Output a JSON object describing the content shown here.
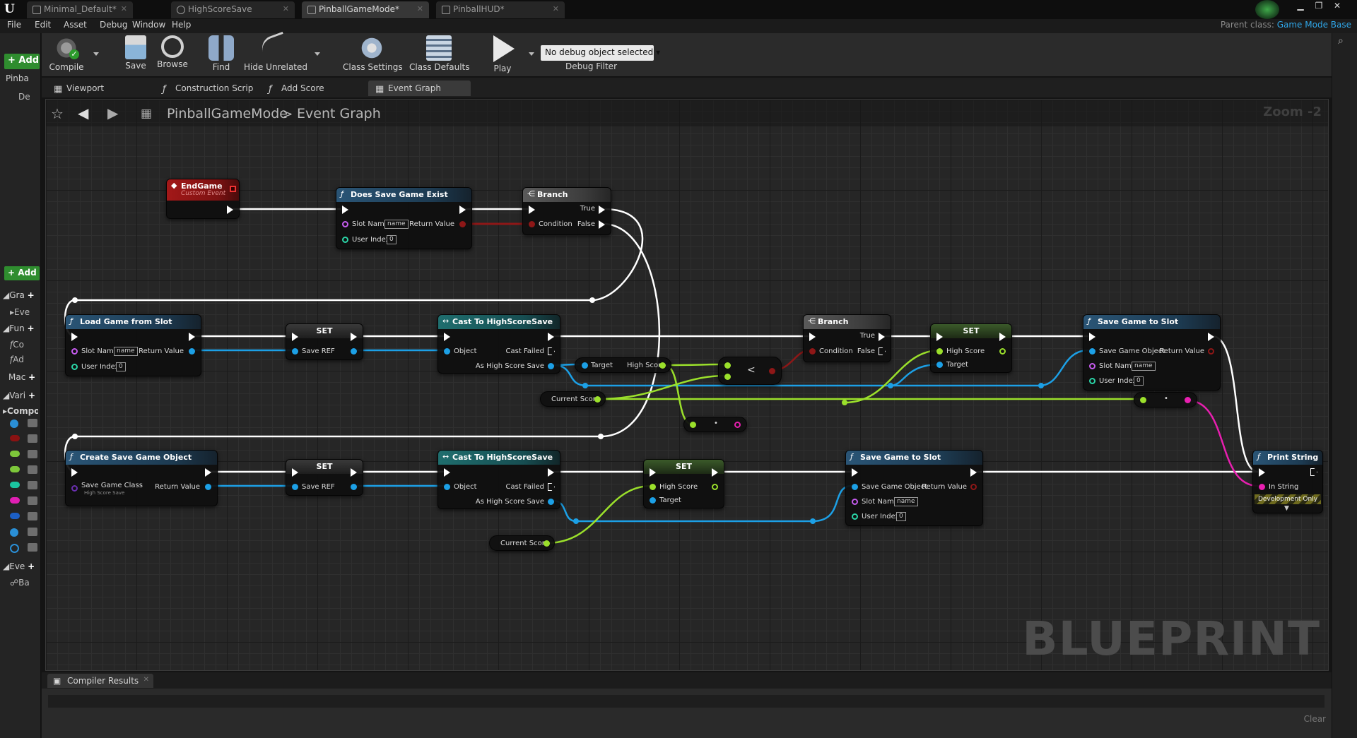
{
  "titlebar": {
    "tabs": [
      {
        "label": "Minimal_Default*",
        "icon": "level-icon"
      },
      {
        "label": "HighScoreSave",
        "icon": "savegame-icon"
      },
      {
        "label": "PinballGameMode*",
        "icon": "blueprint-icon"
      },
      {
        "label": "PinballHUD*",
        "icon": "widget-icon"
      }
    ],
    "parent_prefix": "Parent class:",
    "parent_class": "Game Mode Base"
  },
  "menu": [
    "File",
    "Edit",
    "Asset",
    "Debug",
    "Window",
    "Help"
  ],
  "toolbar": {
    "compile": "Compile",
    "save": "Save",
    "browse": "Browse",
    "find": "Find",
    "hide_unrelated": "Hide Unrelated",
    "class_settings": "Class Settings",
    "class_defaults": "Class Defaults",
    "play": "Play",
    "debug_select": "No debug object selected",
    "debug_filter": "Debug Filter"
  },
  "left_panel": {
    "add": "+ Add",
    "component": "Pinba",
    "default": "De",
    "add_new": "+ Add N",
    "sections": {
      "graphs": "Gra",
      "graph_item": "Eve",
      "functions": "Fun",
      "func1": "Co",
      "func2": "Ad",
      "macros": "Mac",
      "variables": "Vari",
      "components": "Compon",
      "event_dispatchers": "Eve",
      "dispatcher_item": "Ba"
    },
    "var_colors": [
      "#2a8fd6",
      "#8a1212",
      "#7dc73a",
      "#7dc73a",
      "#1bc4a0",
      "#e01fb3",
      "#1c5fc4",
      "#2a8fd6",
      "#2a8fd6"
    ]
  },
  "graph_tabs": [
    {
      "label": "Viewport"
    },
    {
      "label": "Construction Scrip"
    },
    {
      "label": "Add Score"
    },
    {
      "label": "Event Graph"
    }
  ],
  "breadcrumb": {
    "blueprint": "PinballGameMode",
    "separator": ">",
    "graph": "Event Graph"
  },
  "zoom": "Zoom -2",
  "watermark": "BLUEPRINT",
  "nodes": {
    "end_game": {
      "title": "EndGame",
      "subtitle": "Custom Event"
    },
    "does_save_exist": {
      "title": "Does Save Game Exist",
      "slot_name": "Slot Name",
      "slot_value": "name",
      "user_index": "User Index",
      "user_index_value": "0",
      "return_value": "Return Value"
    },
    "branch1": {
      "title": "Branch",
      "condition": "Condition",
      "true": "True",
      "false": "False"
    },
    "load_game": {
      "title": "Load Game from Slot",
      "slot_name": "Slot Name",
      "slot_value": "name",
      "user_index": "User Index",
      "user_index_value": "0",
      "return_value": "Return Value"
    },
    "set1": {
      "title": "SET",
      "pin": "Save REF"
    },
    "cast1": {
      "title": "Cast To HighScoreSave",
      "object": "Object",
      "cast_failed": "Cast Failed",
      "as_save": "As High Score Save"
    },
    "get_highscore": {
      "target": "Target",
      "value": "High Score"
    },
    "current_score1": {
      "label": "Current Score"
    },
    "less": {
      "symbol": "<"
    },
    "branch2": {
      "title": "Branch",
      "condition": "Condition",
      "true": "True",
      "false": "False"
    },
    "set_highscore1": {
      "title": "SET",
      "high_score": "High Score",
      "target": "Target"
    },
    "save_slot1": {
      "title": "Save Game to Slot",
      "save_obj": "Save Game Object",
      "slot_name": "Slot Name",
      "slot_value": "name",
      "user_index": "User Index",
      "user_index_value": "0",
      "return_value": "Return Value"
    },
    "tostring1": {
      "symbol": "•"
    },
    "tostring2": {
      "symbol": "•"
    },
    "create_save": {
      "title": "Create Save Game Object",
      "class_label": "Save Game Class",
      "class_value": "High Score Save",
      "return_value": "Return Value"
    },
    "set2": {
      "title": "SET",
      "pin": "Save REF"
    },
    "cast2": {
      "title": "Cast To HighScoreSave",
      "object": "Object",
      "cast_failed": "Cast Failed",
      "as_save": "As High Score Save"
    },
    "set_highscore2": {
      "title": "SET",
      "high_score": "High Score",
      "target": "Target"
    },
    "current_score2": {
      "label": "Current Score"
    },
    "save_slot2": {
      "title": "Save Game to Slot",
      "save_obj": "Save Game Object",
      "slot_name": "Slot Name",
      "slot_value": "name",
      "user_index": "User Index",
      "user_index_value": "0",
      "return_value": "Return Value"
    },
    "print_string": {
      "title": "Print String",
      "in_string": "In String",
      "dev_only": "Development Only"
    }
  },
  "colors": {
    "exec": "#ffffff",
    "object": "#1ca0e6",
    "float": "#9be02b",
    "bool": "#8e1717",
    "string": "#e81fb0",
    "name": "#c75cf0",
    "int": "#2bd6a8"
  },
  "compiler": {
    "tab": "Compiler Results",
    "clear": "Clear"
  }
}
